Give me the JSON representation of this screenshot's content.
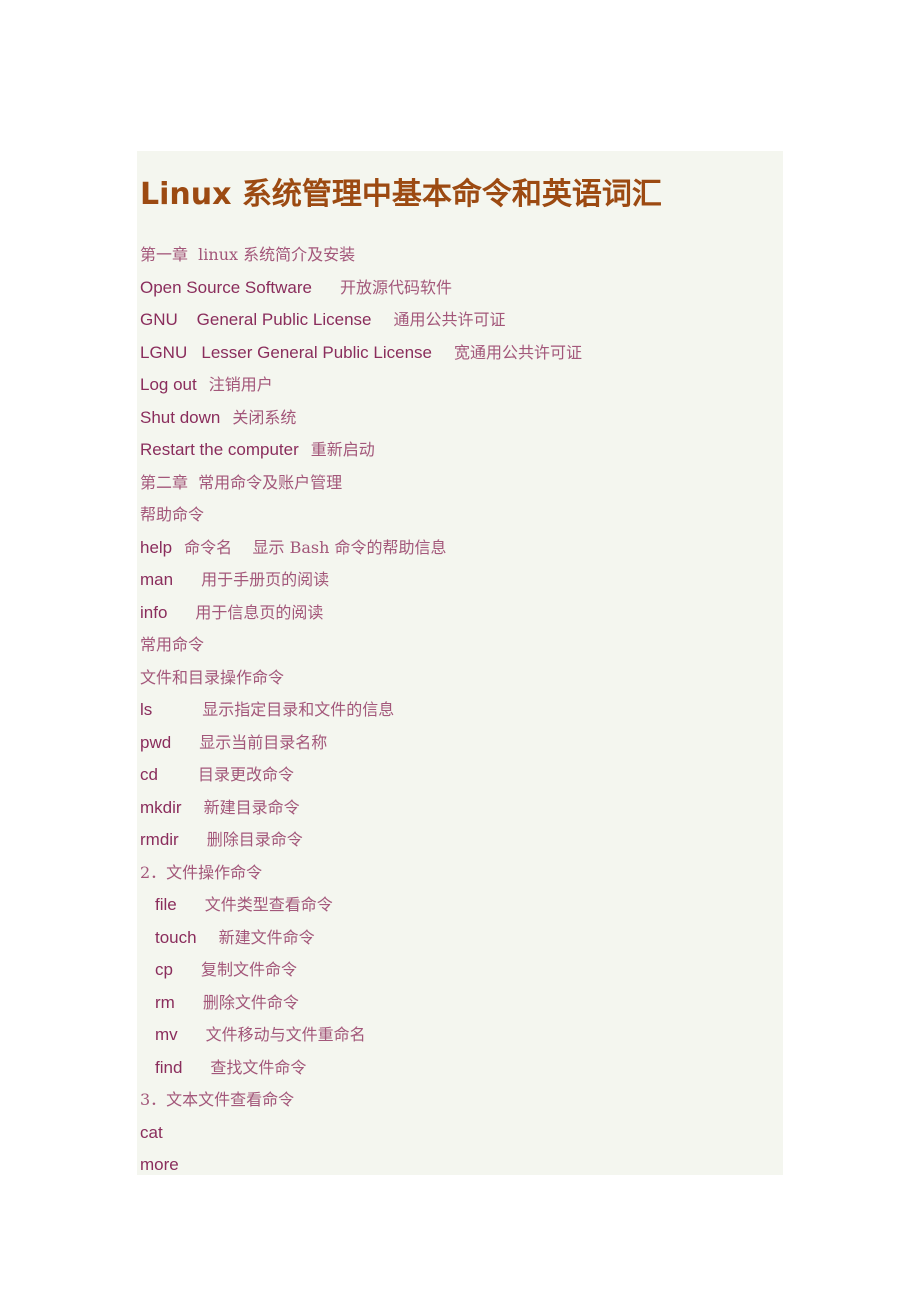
{
  "document": {
    "title": "Linux 系统管理中基本命令和英语词汇",
    "colors": {
      "title": "#9c4a12",
      "text": "#8a2d5c",
      "gloss": "#a3577a",
      "background": "#f4f6ef"
    },
    "lines": [
      {
        "type": "heading",
        "text": "第一章  linux 系统简介及安装"
      },
      {
        "type": "entry",
        "term": "Open Source Software",
        "gloss": "开放源代码软件"
      },
      {
        "type": "entry",
        "term": "GNU    General Public License",
        "gloss": "通用公共许可证"
      },
      {
        "type": "entry",
        "term": "LGNU   Lesser General Public License",
        "gloss": "宽通用公共许可证"
      },
      {
        "type": "entry",
        "term": "Log out",
        "gloss": "注销用户"
      },
      {
        "type": "entry",
        "term": "Shut down",
        "gloss": "关闭系统"
      },
      {
        "type": "entry",
        "term": "Restart the computer",
        "gloss": "重新启动"
      },
      {
        "type": "heading",
        "text": "第二章  常用命令及账户管理"
      },
      {
        "type": "heading",
        "text": "帮助命令"
      },
      {
        "type": "entry",
        "term": "help",
        "gloss": "命令名    显示 Bash 命令的帮助信息"
      },
      {
        "type": "entry",
        "term": "man",
        "gloss": "用于手册页的阅读"
      },
      {
        "type": "entry",
        "term": "info",
        "gloss": "用于信息页的阅读"
      },
      {
        "type": "heading",
        "text": "常用命令"
      },
      {
        "type": "heading",
        "text": "文件和目录操作命令"
      },
      {
        "type": "entry",
        "term": "ls",
        "gloss": "显示指定目录和文件的信息"
      },
      {
        "type": "entry",
        "term": "pwd",
        "gloss": "显示当前目录名称"
      },
      {
        "type": "entry",
        "term": "cd",
        "gloss": "目录更改命令"
      },
      {
        "type": "entry",
        "term": "mkdir",
        "gloss": "新建目录命令"
      },
      {
        "type": "entry",
        "term": "rmdir",
        "gloss": "删除目录命令"
      },
      {
        "type": "heading",
        "text": "2．文件操作命令"
      },
      {
        "type": "entry",
        "indent": true,
        "term": "file",
        "gloss": "文件类型查看命令"
      },
      {
        "type": "entry",
        "indent": true,
        "term": "touch",
        "gloss": "新建文件命令"
      },
      {
        "type": "entry",
        "indent": true,
        "term": "cp",
        "gloss": "复制文件命令"
      },
      {
        "type": "entry",
        "indent": true,
        "term": "rm",
        "gloss": "删除文件命令"
      },
      {
        "type": "entry",
        "indent": true,
        "term": "mv",
        "gloss": "文件移动与文件重命名"
      },
      {
        "type": "entry",
        "indent": true,
        "term": "find",
        "gloss": "查找文件命令"
      },
      {
        "type": "heading",
        "text": "3．文本文件查看命令"
      },
      {
        "type": "entry",
        "term": "cat",
        "gloss": ""
      },
      {
        "type": "entry",
        "term": "more",
        "gloss": ""
      }
    ]
  }
}
